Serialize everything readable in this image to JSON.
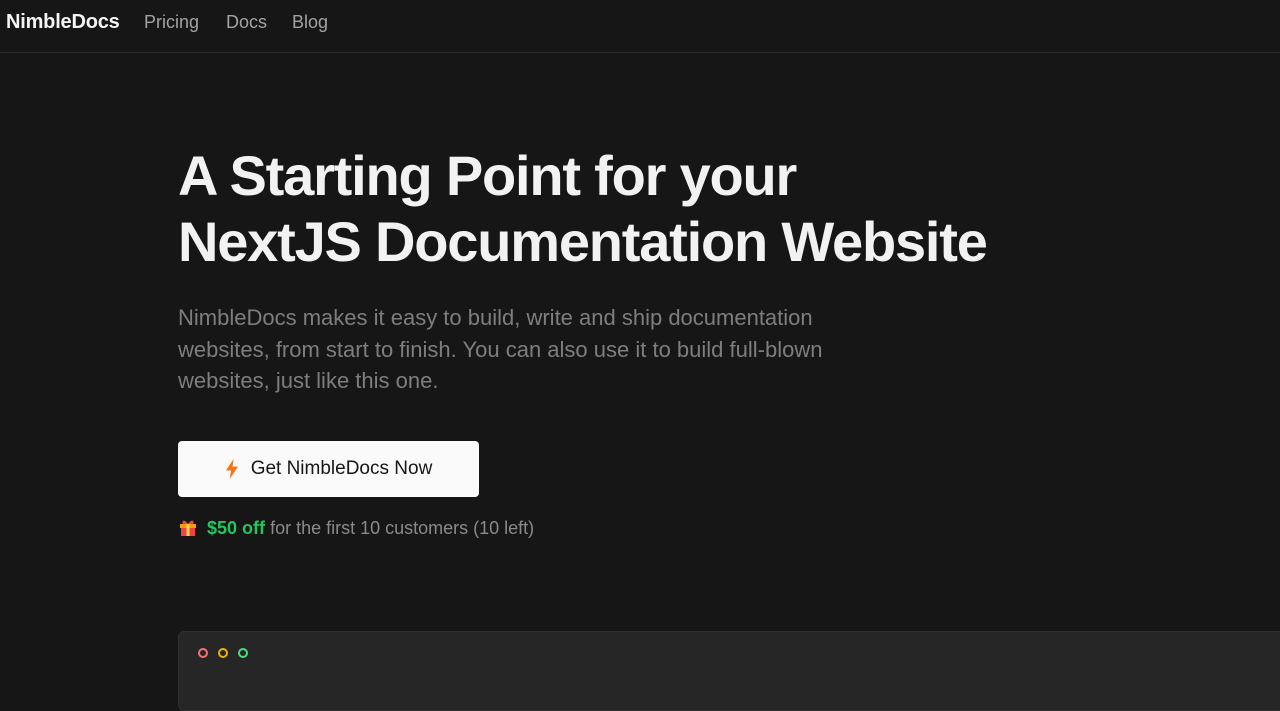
{
  "header": {
    "brand": "NimbleDocs",
    "nav": [
      "Pricing",
      "Docs",
      "Blog"
    ]
  },
  "hero": {
    "title_line1": "A Starting Point for your",
    "title_line2": "NextJS Documentation Website",
    "subtitle": "NimbleDocs makes it easy to build, write and ship documentation websites, from start to finish. You can also use it to build full-blown websites, just like this one.",
    "cta_label": "Get NimbleDocs Now",
    "cta_icon": "lightning-bolt-icon",
    "promo_icon": "gift-icon",
    "promo_highlight": "$50 off",
    "promo_text": "for the first 10 customers (10 left)"
  },
  "preview_window": {
    "controls": [
      "close",
      "minimize",
      "maximize"
    ]
  },
  "colors": {
    "background": "#161616",
    "accent_green": "#22c55e",
    "bolt_orange": "#f97316",
    "dot_red": "#f87171",
    "dot_yellow": "#eab308",
    "dot_green": "#4ade80"
  }
}
